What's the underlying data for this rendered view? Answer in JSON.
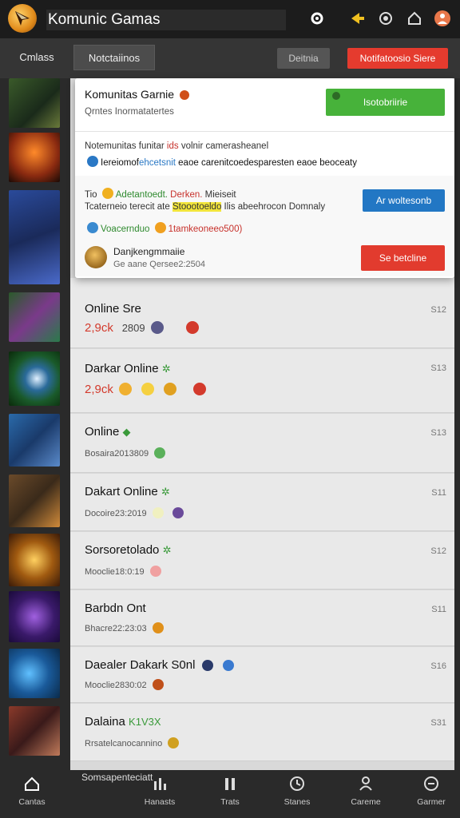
{
  "header": {
    "title": "Komunic Gamas",
    "icons": [
      "gear-icon",
      "pin-icon",
      "target-icon",
      "home-icon",
      "profile-icon"
    ]
  },
  "tabs": {
    "tab1": "Cmlass",
    "tab2": "Notctaiinos",
    "gray_button": "Deitnia",
    "red_button": "Notifatoosio Siere"
  },
  "popup": {
    "title": "Komunitas Garnie",
    "subtitle": "Qrntes  Inormatatertes",
    "green_button": "Isotobriirie",
    "line1_a": "Notemunitas funitar ",
    "line1_hl": "ids",
    "line1_b": " volnir camerasheanel",
    "line2_a": "Iereiomof",
    "line2_hl": "ehcetsnit",
    "line2_b": " eaoe carenitcoedesparesten eaoe beoceaty",
    "line3_a": "Tio ",
    "line3_g": "Adetantoedt.",
    "line3_r": " Derken.",
    "line3_b": " Mieiseit",
    "blue_button": "Ar woltesonb",
    "line4_a": "Tcaterneio terecit ate ",
    "line4_y": "Stoootoeldo",
    "line4_b": " Ilis abeehrocon Domnaly",
    "line5_a": "Voacernduo ",
    "line5_r": "1tamkeoneeo500)",
    "name": "Danjkengmmaiie",
    "meta": "Ge aane Qersee2:2504",
    "red_button": "Se betcline"
  },
  "rows": [
    {
      "title": "Online Sre",
      "sub": "2,9ck",
      "sub_b": "2809",
      "time": "S12"
    },
    {
      "title": "Darkar Online",
      "sub": "2,9ck",
      "sub_b": "",
      "time": "S13"
    },
    {
      "title": "Online",
      "sub": "Bosaira2013809",
      "sub_b": "",
      "time": "S13"
    },
    {
      "title": "Dakart Online",
      "sub": "Docoire23:2019",
      "sub_b": "",
      "time": "S11"
    },
    {
      "title": "Sorsoretolado",
      "sub": "Mooclie18:0:19",
      "sub_b": "",
      "time": "S12"
    },
    {
      "title": "Barbdn Ont",
      "sub": "Bhacre22:23:03",
      "sub_b": "",
      "time": "S11"
    },
    {
      "title": "Daealer Dakark S0nl",
      "sub": "Mooclie2830:02",
      "sub_b": "",
      "time": "S16"
    },
    {
      "title": "Dalaina",
      "sub": "Rrsatelcanocannino",
      "sub_b": "",
      "time": "S31"
    }
  ],
  "row_badges": {
    "r1": "",
    "r2": "",
    "r3": "",
    "r4": "",
    "r5": "",
    "r8": "K1V3X"
  },
  "bottomnav": {
    "overlay": "Somsapenteciatt",
    "items": [
      "Cantas",
      "Hanasts",
      "Trats",
      "Stanes",
      "Careme",
      "Garmer"
    ]
  }
}
